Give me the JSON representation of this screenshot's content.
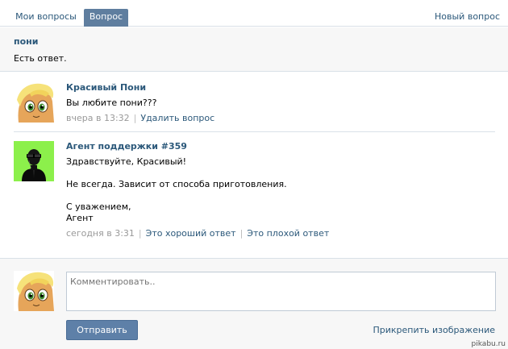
{
  "tabs": {
    "my_questions": "Мои вопросы",
    "question": "Вопрос",
    "new_question": "Новый вопрос"
  },
  "question": {
    "title": "пони",
    "status": "Есть ответ."
  },
  "posts": [
    {
      "author": "Красивый Пони",
      "lines": [
        "Вы любите пони???"
      ],
      "time": "вчера в 13:32",
      "actions": [
        "Удалить вопрос"
      ]
    },
    {
      "author": "Агент поддержки #359",
      "lines": [
        "Здравствуйте, Красивый!",
        "",
        "Не всегда. Зависит от способа приготовления.",
        "",
        "С уважением,",
        "Агент"
      ],
      "time": "сегодня в 3:31",
      "actions": [
        "Это хороший ответ",
        "Это плохой ответ"
      ]
    }
  ],
  "reply": {
    "placeholder": "Комментировать..",
    "send_label": "Отправить",
    "attach_label": "Прикрепить изображение"
  },
  "watermark": "pikabu.ru",
  "icons": {
    "pony_avatar": "pony-avatar-icon",
    "agent_avatar": "agent-avatar-icon"
  },
  "colors": {
    "link": "#2b587a",
    "tab_active": "#5f7e9f",
    "button": "#5e80a8",
    "agent_avatar_bg": "#8cf04b"
  }
}
